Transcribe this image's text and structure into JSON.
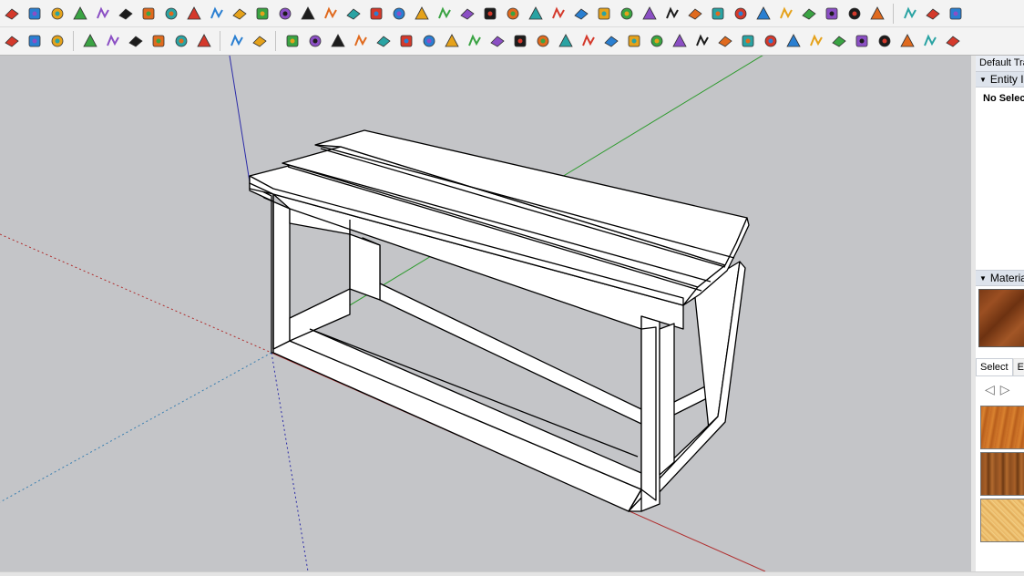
{
  "toolbar_top": {
    "icons": [
      "paint-bucket-icon",
      "layer-icon",
      "face-icon",
      "surface-icon",
      "plane-icon",
      "eraser-icon",
      "rotate-arc-icon",
      "rectangle-red-icon",
      "section-icon",
      "flag-icon",
      "house-icon",
      "cylinder-icon",
      "corner-icon",
      "bezier-icon",
      "add-icon",
      "move-cross-icon",
      "scale-icon",
      "pyramid-icon",
      "cone-icon",
      "warning-icon",
      "loop-icon",
      "ring-icon",
      "circle-icon",
      "axes-icon",
      "box-icon",
      "undo-arc-icon",
      "puzzle-icon",
      "component-icon",
      "component-red-icon",
      "component-pair-icon",
      "sticker-icon",
      "dots-icon",
      "image-icon",
      "texture-icon",
      "grid-icon",
      "wood-grid-icon",
      "close-points-icon",
      "arc-points-icon",
      "cube-grid-icon",
      "cube-a-icon",
      "cube-b-icon",
      "cube-c-icon"
    ]
  },
  "toolbar_second": {
    "icons": [
      "swap-icon",
      "refresh-icon",
      "flip-icon",
      "add-circle-icon",
      "tree-icon",
      "camera-icon",
      "checker-icon",
      "cloud-icon",
      "settings-icon",
      "mail-icon",
      "info-icon",
      "path-icon",
      "curve-icon",
      "edit-icon",
      "cut-icon",
      "lasso-icon",
      "chain-icon",
      "bend-icon",
      "box-edit-icon",
      "sphere-icon",
      "angle-icon",
      "corner-square-icon",
      "corner-line-icon",
      "knife-icon",
      "sweep-icon",
      "mirror-icon",
      "fold-icon",
      "comb-icon",
      "array-icon",
      "vase-icon",
      "hand-icon",
      "shell-icon",
      "plane-cut-icon",
      "stack-icon",
      "sheet-icon",
      "sharp-icon",
      "joint-icon",
      "fan-icon",
      "hook-icon",
      "bracket-icon",
      "square-block-icon"
    ]
  },
  "tray": {
    "title": "Default Tray",
    "entity_header": "Entity Info",
    "entity_status": "No Selection",
    "materials_header": "Materials",
    "tab_select": "Select",
    "tab_edit": "Edit",
    "nav_back": "◁",
    "nav_forward": "▷"
  },
  "colors": {
    "viewport_bg": "#c4c5c8",
    "axis_red": "#b03030",
    "axis_green": "#2e9b2e",
    "axis_blue": "#2c2ca8",
    "model_face": "#ffffff",
    "model_edge": "#000000"
  }
}
